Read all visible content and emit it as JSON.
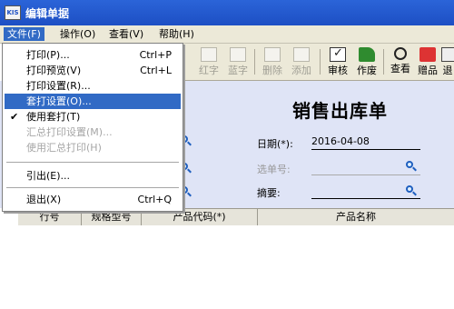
{
  "window": {
    "app_icon_text": "KIS",
    "title": "编辑单据"
  },
  "menubar": {
    "items": [
      {
        "label": "文件(F)"
      },
      {
        "label": "操作(O)"
      },
      {
        "label": "查看(V)"
      },
      {
        "label": "帮助(H)"
      }
    ]
  },
  "toolbar": {
    "buttons": [
      {
        "label": "红字",
        "enabled": false
      },
      {
        "label": "蓝字",
        "enabled": false
      },
      {
        "label": "删除",
        "enabled": false
      },
      {
        "label": "添加",
        "enabled": false
      },
      {
        "label": "审核",
        "enabled": true
      },
      {
        "label": "作废",
        "enabled": true
      },
      {
        "label": "查看",
        "enabled": true
      },
      {
        "label": "赠品",
        "enabled": true
      },
      {
        "label": "退",
        "enabled": true
      }
    ]
  },
  "document": {
    "title": "销售出库单",
    "date_label": "日期(*):",
    "date_value": "2016-04-08",
    "select_order_label": "选单号:",
    "select_order_value": "",
    "summary_label": "摘要:",
    "summary_value": ""
  },
  "grid": {
    "columns": [
      "行号",
      "规格型号",
      "产品代码(*)",
      "产品名称"
    ]
  },
  "file_menu": {
    "items": [
      {
        "label": "打印(P)...",
        "shortcut": "Ctrl+P",
        "enabled": true
      },
      {
        "label": "打印预览(V)",
        "shortcut": "Ctrl+L",
        "enabled": true
      },
      {
        "label": "打印设置(R)...",
        "shortcut": "",
        "enabled": true
      },
      {
        "label": "套打设置(O)...",
        "shortcut": "",
        "enabled": true,
        "highlighted": true
      },
      {
        "label": "使用套打(T)",
        "shortcut": "",
        "enabled": true,
        "checked": true
      },
      {
        "label": "汇总打印设置(M)...",
        "shortcut": "",
        "enabled": false
      },
      {
        "label": "使用汇总打印(H)",
        "shortcut": "",
        "enabled": false
      },
      {
        "label": "引出(E)...",
        "shortcut": "",
        "enabled": true
      },
      {
        "label": "退出(X)",
        "shortcut": "Ctrl+Q",
        "enabled": true
      }
    ],
    "check_symbol": "✔"
  },
  "colors": {
    "highlight": "#316ac5",
    "titlebar": "#2b64d8",
    "doc_background": "#dfe4f6"
  }
}
